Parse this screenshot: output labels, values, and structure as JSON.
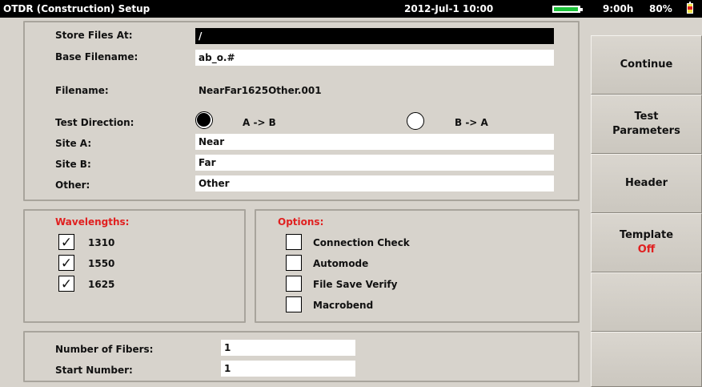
{
  "status_bar": {
    "title": "OTDR (Construction) Setup",
    "datetime": "2012-Jul-1 10:00",
    "battery_level": 0.9,
    "battery_color": "#1dc33a",
    "time_remaining": "9:00h",
    "battery_percent": "80%"
  },
  "form": {
    "store_files_at": {
      "label": "Store Files At:",
      "value": "/"
    },
    "base_filename": {
      "label": "Base Filename:",
      "value": "ab_o.#"
    },
    "filename": {
      "label": "Filename:",
      "value": "NearFar1625Other.001"
    },
    "test_direction": {
      "label": "Test Direction:",
      "options": [
        "A -> B",
        "B -> A"
      ],
      "selected": "A -> B"
    },
    "site_a": {
      "label": "Site A:",
      "value": "Near"
    },
    "site_b": {
      "label": "Site B:",
      "value": "Far"
    },
    "other": {
      "label": "Other:",
      "value": "Other"
    }
  },
  "wavelengths": {
    "heading": "Wavelengths:",
    "items": [
      {
        "label": "1310",
        "checked": true
      },
      {
        "label": "1550",
        "checked": true
      },
      {
        "label": "1625",
        "checked": true
      }
    ]
  },
  "options": {
    "heading": "Options:",
    "items": [
      {
        "label": "Connection Check",
        "checked": false
      },
      {
        "label": "Automode",
        "checked": false
      },
      {
        "label": "File Save Verify",
        "checked": false
      },
      {
        "label": "Macrobend",
        "checked": false
      }
    ]
  },
  "fibers": {
    "number_of_fibers": {
      "label": "Number of Fibers:",
      "value": "1"
    },
    "start_number": {
      "label": "Start Number:",
      "value": "1"
    }
  },
  "softkeys": {
    "continue": "Continue",
    "test_parameters_line1": "Test",
    "test_parameters_line2": "Parameters",
    "header": "Header",
    "template": "Template",
    "template_state": "Off"
  },
  "colors": {
    "accent_red": "#e02020",
    "background": "#d7d3cc"
  }
}
